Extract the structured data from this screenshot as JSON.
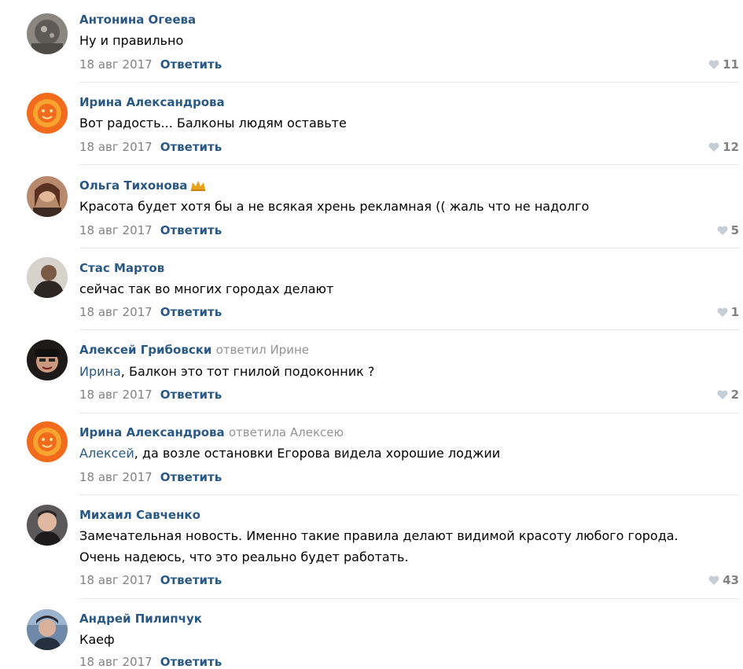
{
  "comments": [
    {
      "author": "Антонина Огеева",
      "reply_note": "",
      "mention": "",
      "text": "Ну и правильно",
      "date": "18 авг 2017",
      "reply_label": "Ответить",
      "likes": "11",
      "avatar": {
        "icon": "avatar-photo",
        "color": "#6d6a66"
      }
    },
    {
      "author": "Ирина Александрова",
      "reply_note": "",
      "mention": "",
      "text": "Вот радость... Балконы людям оставьте",
      "date": "18 авг 2017",
      "reply_label": "Ответить",
      "likes": "12",
      "avatar": {
        "icon": "sun-face-avatar",
        "color": "#f26a1b"
      }
    },
    {
      "author": "Ольга Тихонова",
      "reply_note": "",
      "mention": "",
      "text": "Красота будет хотя бы а не всякая хрень рекламная (( жаль что не надолго",
      "date": "18 авг 2017",
      "reply_label": "Ответить",
      "likes": "5",
      "badge": "crown-icon",
      "avatar": {
        "icon": "avatar-photo",
        "color": "#8a5a44"
      }
    },
    {
      "author": "Стас Мартов",
      "reply_note": "",
      "mention": "",
      "text": "сейчас так во многих городах делают",
      "date": "18 авг 2017",
      "reply_label": "Ответить",
      "likes": "1",
      "avatar": {
        "icon": "avatar-photo",
        "color": "#4a3a30"
      }
    },
    {
      "author": "Алексей Грибовски",
      "reply_note": "ответил Ирине",
      "mention": "Ирина",
      "text": ", Балкон это тот гнилой подоконник ?",
      "date": "18 авг 2017",
      "reply_label": "Ответить",
      "likes": "2",
      "avatar": {
        "icon": "avatar-photo",
        "color": "#2b2424"
      }
    },
    {
      "author": "Ирина Александрова",
      "reply_note": "ответила Алексею",
      "mention": "Алексей",
      "text": ", да возле остановки Егорова видела хорошие лоджии",
      "date": "18 авг 2017",
      "reply_label": "Ответить",
      "likes": "",
      "avatar": {
        "icon": "sun-face-avatar",
        "color": "#f26a1b"
      }
    },
    {
      "author": "Михаил Савченко",
      "reply_note": "",
      "mention": "",
      "text": "Замечательная новость. Именно такие правила делают видимой красоту любого города.",
      "text2": "Очень надеюсь, что это реально будет работать.",
      "date": "18 авг 2017",
      "reply_label": "Ответить",
      "likes": "43",
      "avatar": {
        "icon": "avatar-photo",
        "color": "#3c3a3a"
      }
    },
    {
      "author": "Андрей Пилипчук",
      "reply_note": "",
      "mention": "",
      "text": "Каеф",
      "date": "18 авг 2017",
      "reply_label": "Ответить",
      "likes": "",
      "avatar": {
        "icon": "avatar-photo",
        "color": "#3e5a78"
      }
    }
  ],
  "colors": {
    "link": "#2a5885",
    "muted": "#828282",
    "divider": "#e5e9ef",
    "heart": "#c5cdd6",
    "crown": "#e9a31a"
  }
}
